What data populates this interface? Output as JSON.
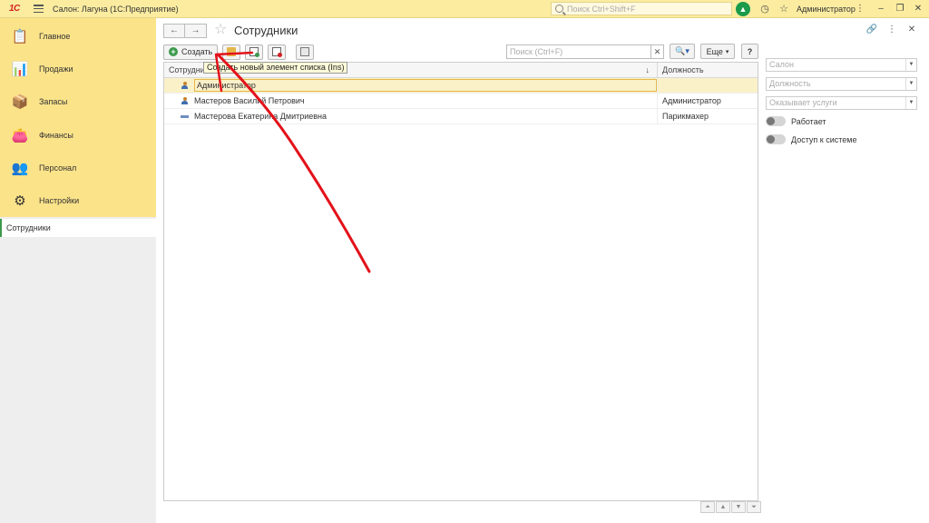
{
  "topbar": {
    "logo": "1С",
    "app_title": "Салон: Лагуна  (1С:Предприятие)",
    "search_placeholder": "Поиск Ctrl+Shift+F",
    "user": "Администратор"
  },
  "sidebar": {
    "sections": [
      {
        "label": "Главное",
        "icon": "clipboard-icon"
      },
      {
        "label": "Продажи",
        "icon": "chart-icon"
      },
      {
        "label": "Запасы",
        "icon": "boxes-icon"
      },
      {
        "label": "Финансы",
        "icon": "wallet-icon"
      },
      {
        "label": "Персонал",
        "icon": "people-icon"
      },
      {
        "label": "Настройки",
        "icon": "gear-icon"
      }
    ],
    "open_item": "Сотрудники"
  },
  "main": {
    "title": "Сотрудники",
    "toolbar": {
      "create_label": "Создать",
      "search_placeholder": "Поиск (Ctrl+F)",
      "more_label": "Еще",
      "help_label": "?"
    },
    "tooltip": "Создать новый элемент списка (Ins)",
    "table": {
      "columns": [
        "Сотрудник",
        "Должность"
      ],
      "rows": [
        {
          "name": "Администратор",
          "position": "",
          "icon": "person-icon"
        },
        {
          "name": "Мастеров Василий Петрович",
          "position": "Администратор",
          "icon": "person-icon"
        },
        {
          "name": "Мастерова Екатерина Дмитриевна",
          "position": "Парикмахер",
          "icon": "marked-item-icon"
        }
      ]
    }
  },
  "filters": {
    "salon_placeholder": "Салон",
    "position_placeholder": "Должность",
    "services_placeholder": "Оказывает услуги",
    "toggles": [
      {
        "label": "Работает",
        "on": false
      },
      {
        "label": "Доступ к системе",
        "on": false
      }
    ]
  },
  "colors": {
    "topbar": "#fbeca0",
    "sidebar_sections": "#fbe38a",
    "accent_green": "#3c9a4d",
    "annotation_red": "#e3121a"
  }
}
